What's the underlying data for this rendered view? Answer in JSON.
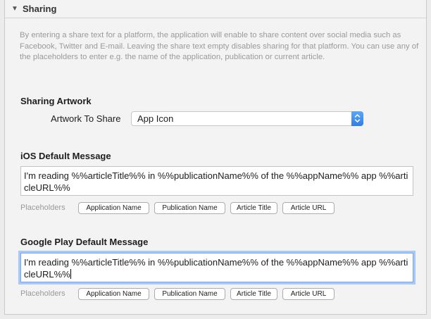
{
  "section": {
    "title": "Sharing"
  },
  "description": "By entering a share text for a platform, the application will enable to share content over social media such as Facebook, Twitter and E-mail. Leaving the share text empty disables sharing for that platform. You can use any of the placeholders to enter e.g. the name of the application, publication or current article.",
  "artwork": {
    "heading": "Sharing Artwork",
    "label": "Artwork To Share",
    "selected": "App Icon"
  },
  "ios": {
    "heading": "iOS Default Message",
    "message": "I'm reading %%articleTitle%% in %%publicationName%% of the %%appName%% app %%articleURL%%"
  },
  "google": {
    "heading": "Google Play Default Message",
    "message": "I'm reading %%articleTitle%% in %%publicationName%% of the %%appName%% app %%articleURL%%"
  },
  "placeholders": {
    "label": "Placeholders",
    "buttons": [
      "Application Name",
      "Publication Name",
      "Article Title",
      "Article URL"
    ]
  },
  "icons": {
    "disclosure": "disclosure-triangle-down-icon",
    "stepper": "updown-chevron-icon"
  },
  "colors": {
    "accent": "#2f7ee8",
    "focus_ring": "#a9c8f3",
    "muted_text": "#9a9a9a"
  }
}
